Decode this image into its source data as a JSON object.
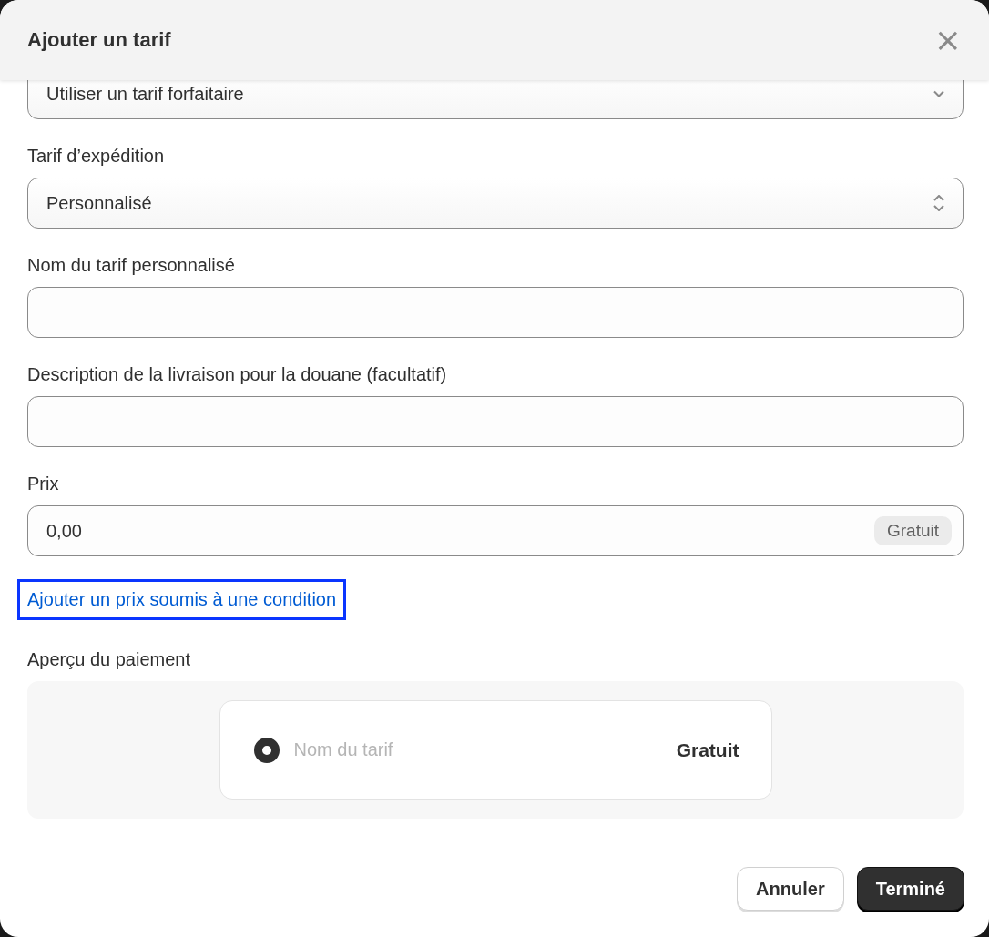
{
  "dialog": {
    "title": "Ajouter un tarif",
    "close_icon": "×"
  },
  "fields": [
    {
      "kind": "select",
      "value": "Utiliser un tarif forfaitaire",
      "stepper": false
    },
    {
      "kind": "select",
      "label": "Tarif d’expédition",
      "value": "Personnalisé",
      "stepper": true
    },
    {
      "kind": "input",
      "label": "Nom du tarif personnalisé"
    },
    {
      "kind": "input",
      "label": "Description de la livraison pour la douane (facultatif)"
    },
    {
      "kind": "input",
      "label": "Prix",
      "value": "0,00",
      "badge": "Gratuit"
    }
  ],
  "conditional_link": {
    "text": "Ajouter un prix soumis à une condition",
    "focused": true
  },
  "preview": {
    "label": "Aperçu du paiement",
    "option": {
      "rate_name": "Nom du tarif",
      "price": "Gratuit",
      "selected": true
    }
  },
  "buttons": [
    {
      "label": "Annuler",
      "kind": "secondary"
    },
    {
      "label": "Terminé",
      "kind": "primary"
    }
  ]
}
